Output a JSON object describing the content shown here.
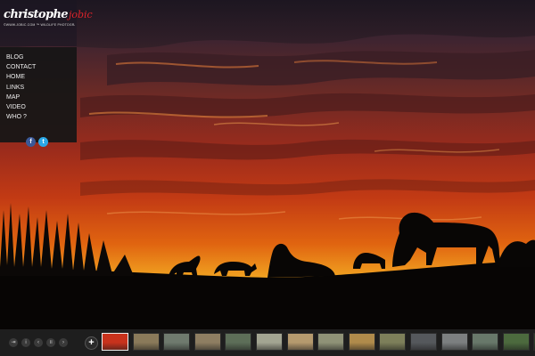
{
  "logo": {
    "name": "christophe",
    "name_accent": "jobic",
    "tagline": "©WWW.JOBIC.COM ™ WILDLIFE PHOTOGRAPHY"
  },
  "menu": [
    {
      "label": "BLOG"
    },
    {
      "label": "CONTACT"
    },
    {
      "label": "HOME"
    },
    {
      "label": "LINKS"
    },
    {
      "label": "MAP"
    },
    {
      "label": "VIDEO"
    },
    {
      "label": "WHO ?"
    }
  ],
  "social": [
    {
      "icon": "facebook-icon",
      "glyph": "f",
      "color": "#3b5998"
    },
    {
      "icon": "twitter-icon",
      "glyph": "t",
      "color": "#2ba8e6"
    }
  ],
  "controls": [
    {
      "icon": "fullscreen-icon",
      "glyph": "⇥"
    },
    {
      "icon": "info-icon",
      "glyph": "i"
    },
    {
      "icon": "previous-icon",
      "glyph": "‹"
    },
    {
      "icon": "pause-icon",
      "glyph": "॥"
    },
    {
      "icon": "next-icon",
      "glyph": "›"
    }
  ],
  "add_button": {
    "glyph": "+",
    "icon": "plus-icon"
  },
  "thumbnails": [
    {
      "color": "#c8321c",
      "active": true
    },
    {
      "color": "#8a7a5a"
    },
    {
      "color": "#6f7a6e"
    },
    {
      "color": "#8e7e62"
    },
    {
      "color": "#5d6e58"
    },
    {
      "color": "#a3a592"
    },
    {
      "color": "#b59a6e"
    },
    {
      "color": "#8f9277"
    },
    {
      "color": "#b08b4b"
    },
    {
      "color": "#7d7f5a"
    },
    {
      "color": "#55585c"
    },
    {
      "color": "#7c7f80"
    },
    {
      "color": "#68786a"
    },
    {
      "color": "#4c6a3e"
    },
    {
      "color": "#2e3d2a"
    }
  ],
  "colors": {
    "accent": "#e0242b",
    "menu_bg": "#161616",
    "bar_bg": "#1e1e1e"
  }
}
